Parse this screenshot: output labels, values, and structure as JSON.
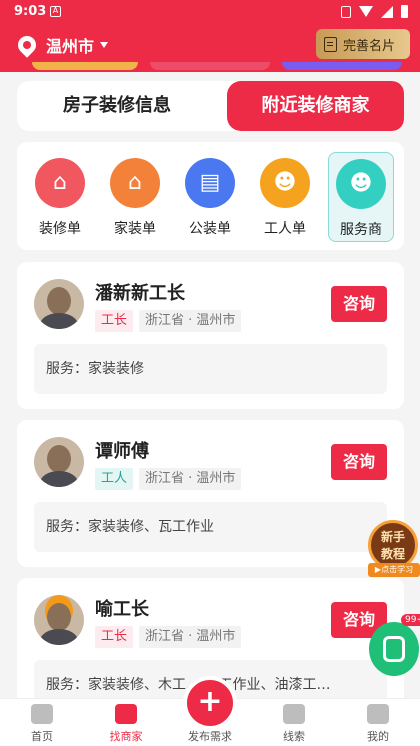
{
  "status_bar": {
    "time": "9:03"
  },
  "header": {
    "city": "温州市",
    "complete_card_label": "完善名片"
  },
  "tabs": [
    {
      "label": "房子装修信息"
    },
    {
      "label": "附近装修商家"
    }
  ],
  "categories": [
    {
      "label": "装修单",
      "icon": "house-people-icon",
      "color": "#f0575f"
    },
    {
      "label": "家装单",
      "icon": "home-icon",
      "color": "#f4813a"
    },
    {
      "label": "公装单",
      "icon": "shop-icon",
      "color": "#4a78f0"
    },
    {
      "label": "工人单",
      "icon": "worker-icon",
      "color": "#f5a31f"
    },
    {
      "label": "服务商",
      "icon": "service-provider-icon",
      "color": "#33cfc1"
    }
  ],
  "merchants": [
    {
      "name": "潘新新工长",
      "role": "工长",
      "region": "浙江省 · 温州市",
      "service": "服务：家装装修",
      "consult_label": "咨询"
    },
    {
      "name": "谭师傅",
      "role": "工人",
      "region": "浙江省 · 温州市",
      "service": "服务：家装装修、瓦工作业",
      "consult_label": "咨询"
    },
    {
      "name": "喻工长",
      "role": "工长",
      "region": "浙江省 · 温州市",
      "service": "服务：家装装修、木工… 瓦工作业、油漆工…",
      "consult_label": "咨询"
    }
  ],
  "floating": {
    "guide_line1": "新手",
    "guide_line2": "教程",
    "guide_strip": "▶点击学习",
    "phone_count": "99+"
  },
  "bottom_nav": [
    {
      "label": "首页",
      "icon": "home-icon"
    },
    {
      "label": "找商家",
      "icon": "find-merchant-icon"
    },
    {
      "label": "发布需求",
      "icon": "plus-icon"
    },
    {
      "label": "线索",
      "icon": "document-icon"
    },
    {
      "label": "我的",
      "icon": "person-icon"
    }
  ],
  "colors": {
    "brand": "#ee2b47",
    "teal": "#22a69a",
    "gold": "#d9b26f"
  }
}
